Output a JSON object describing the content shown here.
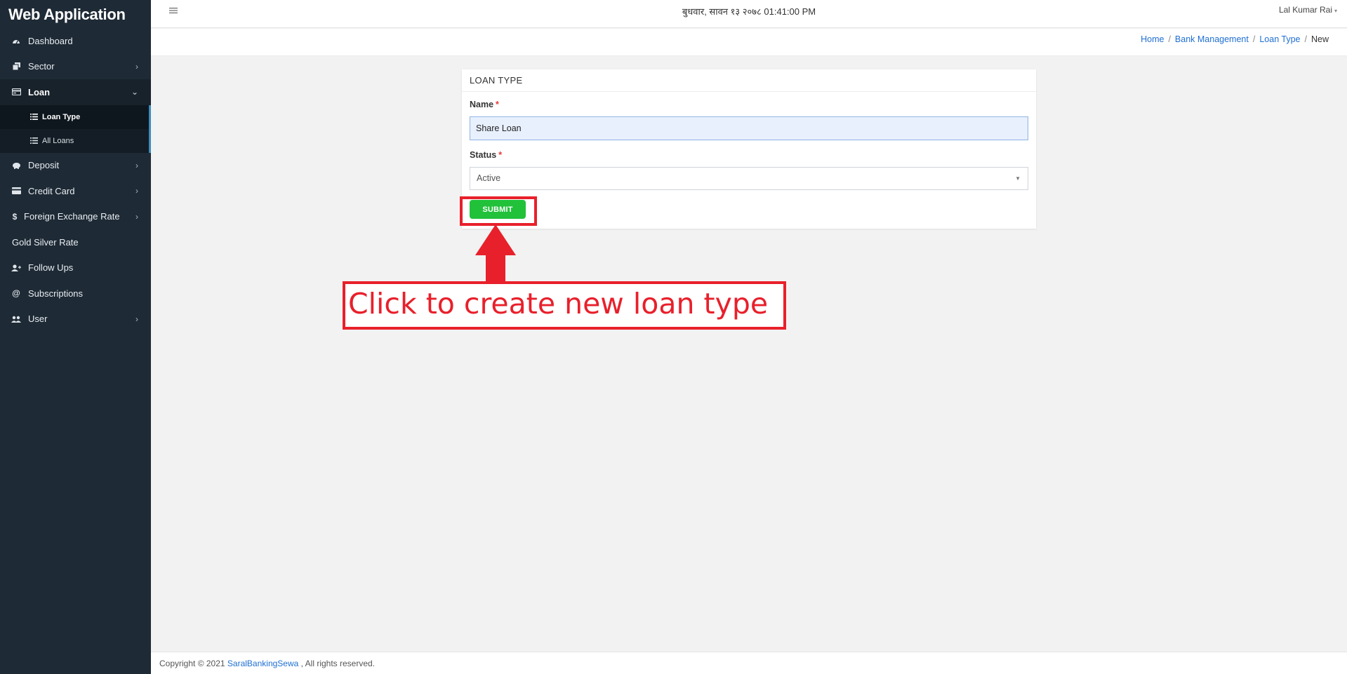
{
  "app": {
    "brand": "Web Application"
  },
  "sidebar": {
    "items": [
      {
        "label": "Dashboard",
        "icon": "dashboard-icon"
      },
      {
        "label": "Sector",
        "icon": "sector-icon"
      },
      {
        "label": "Loan",
        "icon": "loan-icon",
        "expanded": true,
        "children": [
          {
            "label": "Loan Type",
            "active": true
          },
          {
            "label": "All Loans"
          }
        ]
      },
      {
        "label": "Deposit",
        "icon": "piggy-bank-icon"
      },
      {
        "label": "Credit Card",
        "icon": "credit-card-icon"
      },
      {
        "label": "Foreign Exchange Rate",
        "icon": "dollar-icon"
      },
      {
        "label": "Gold Silver Rate"
      },
      {
        "label": "Follow Ups",
        "icon": "user-plus-icon"
      },
      {
        "label": "Subscriptions",
        "icon": "at-icon"
      },
      {
        "label": "User",
        "icon": "users-icon"
      }
    ]
  },
  "topbar": {
    "datetime": "बुधवार, सावन १३ २०७८ 01:41:00 PM",
    "user_name": "Lal Kumar Rai"
  },
  "breadcrumb": {
    "items": [
      "Home",
      "Bank Management",
      "Loan Type"
    ],
    "current": "New"
  },
  "form": {
    "title": "LOAN TYPE",
    "name_label": "Name",
    "name_value": "Share Loan",
    "status_label": "Status",
    "status_value": "Active",
    "required_mark": "*",
    "submit_label": "SUBMIT"
  },
  "annotation": {
    "text": "Click to create new loan type",
    "color": "#e8202b"
  },
  "footer": {
    "prefix": "Copyright © 2021",
    "link": "SaralBankingSewa",
    "suffix": ", All rights reserved."
  },
  "colors": {
    "sidebar_bg": "#1e2a35",
    "submit_green": "#21c13a",
    "link_blue": "#1f6fd1",
    "annotation_red": "#e8202b"
  }
}
